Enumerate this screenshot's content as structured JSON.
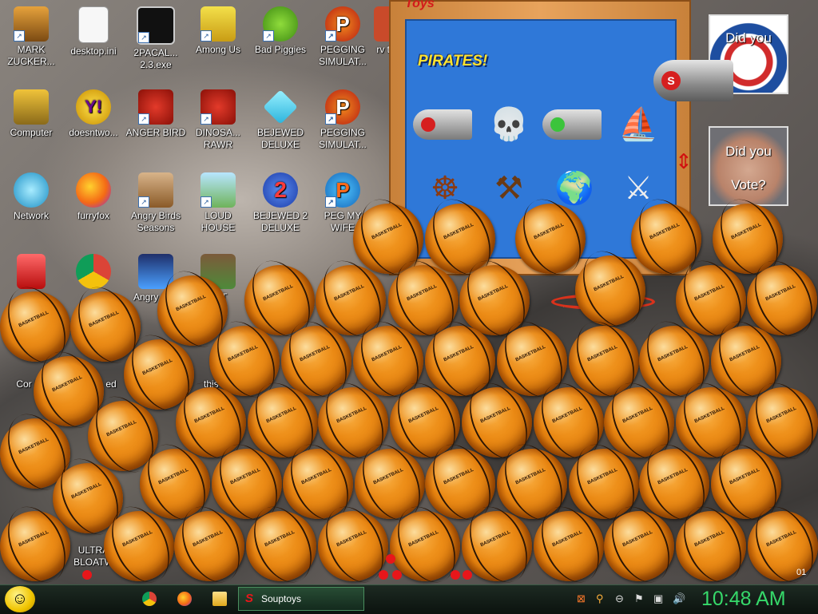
{
  "desktop_icons": [
    {
      "name": "mark-zuckerberg",
      "label": "MARK ZUCKER..."
    },
    {
      "name": "desktop-ini",
      "label": "desktop.ini"
    },
    {
      "name": "2pacalypse-exe",
      "label": "2PACAL... 2.3.exe"
    },
    {
      "name": "among-us",
      "label": "Among Us"
    },
    {
      "name": "bad-piggies",
      "label": "Bad Piggies"
    },
    {
      "name": "pegging-simulator-1",
      "label": "PEGGING SIMULAT..."
    },
    {
      "name": "computer",
      "label": "Computer"
    },
    {
      "name": "doesnt-work",
      "label": "doesntwo..."
    },
    {
      "name": "anger-bird",
      "label": "ANGER BIRD"
    },
    {
      "name": "dinosaur-rawr",
      "label": "DINOSA... RAWR"
    },
    {
      "name": "bejewed-deluxe",
      "label": "BEJEWED DELUXE"
    },
    {
      "name": "pegging-simulator-2",
      "label": "PEGGING SIMULAT..."
    },
    {
      "name": "network",
      "label": "Network"
    },
    {
      "name": "furryfox",
      "label": "furryfox"
    },
    {
      "name": "angry-birds-seasons",
      "label": "Angry Birds Seasons"
    },
    {
      "name": "loud-house",
      "label": "LOUD HOUSE"
    },
    {
      "name": "bejewed-2-deluxe",
      "label": "BEJEWED 2 DELUXE"
    },
    {
      "name": "peg-my-wife",
      "label": "PEG MY WIFE"
    }
  ],
  "partial_labels": {
    "col7_row1": "rv to",
    "angry_birds_space": "Angry Spa",
    "craft": "AFT",
    "control_panel": "Cor Pa",
    "red": "ed",
    "this_s": "this s",
    "ultra_bloatware": "ULTRA BLOATW"
  },
  "soup_window": {
    "title": "Toys",
    "category": "PIRATES!",
    "toys": [
      "cannon-red",
      "skull",
      "cannon-green",
      "pirate-ship",
      "ships-wheel",
      "catapult",
      "globe",
      "sword-stand"
    ]
  },
  "overlays": {
    "obama_caption": "Did you",
    "mccain_caption_1": "Did you",
    "mccain_caption_2": "Vote?",
    "cannon_letter": "S",
    "corner_text": "01"
  },
  "taskbar": {
    "start_icon": "smiley-icon",
    "quick_launch": [
      "chrome-icon",
      "firefox-icon",
      "folder-icon"
    ],
    "active_button": "Souptoys",
    "tray_icons": [
      "souptoys-tray-icon",
      "search-tray-icon",
      "disc-tray-icon",
      "flag-tray-icon",
      "network-tray-icon",
      "volume-tray-icon"
    ],
    "clock": "10:48 AM"
  },
  "colors": {
    "clock": "#36d96a",
    "accent_red": "#e8161a",
    "panel_blue": "#2f78d8"
  }
}
